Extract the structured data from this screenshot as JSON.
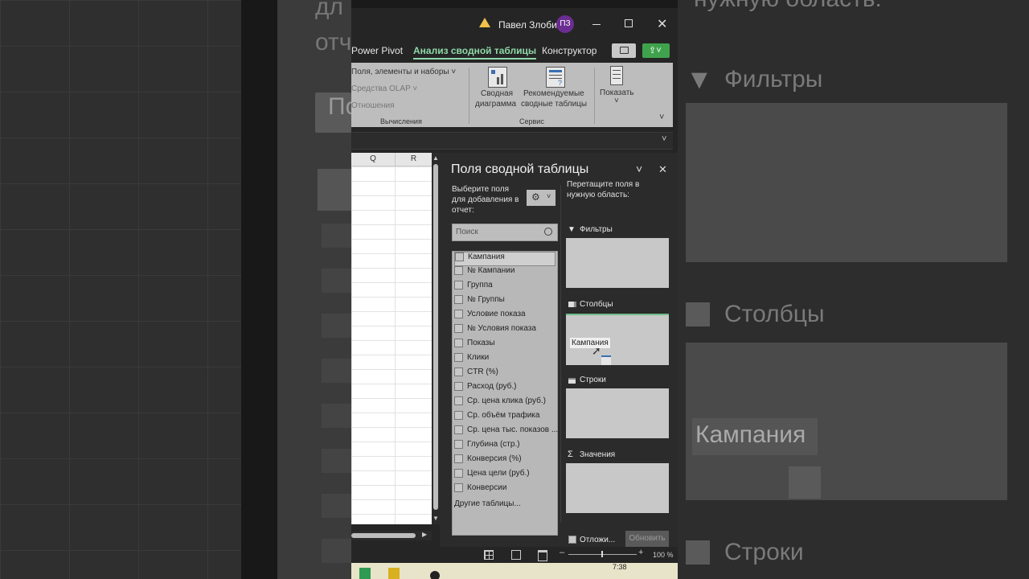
{
  "background": {
    "left_texts": [
      "дл",
      "отч",
      "Пол"
    ],
    "right_texts": {
      "filters": "Фильтры",
      "columns": "Столбцы",
      "chip": "Кампания",
      "rows": "Строки",
      "top": "нужную область:"
    }
  },
  "titlebar": {
    "user_name": "Павел Злобин",
    "avatar_initials": "ПЗ"
  },
  "ribbon_tabs": [
    "Power Pivot",
    "Анализ сводной таблицы",
    "Конструктор"
  ],
  "ribbon": {
    "calc_items": [
      "Поля, элементы и наборы ˅",
      "Средства OLAP ˅",
      "Отношения"
    ],
    "calc_group": "Вычисления",
    "pivot_chart": [
      "Сводная",
      "диаграмма"
    ],
    "recommended": [
      "Рекомендуемые",
      "сводные таблицы"
    ],
    "service_group": "Сервис",
    "show": "Показать"
  },
  "sheet": {
    "columns": [
      "Q",
      "R"
    ]
  },
  "pane": {
    "title": "Поля сводной таблицы",
    "choose_fields": [
      "Выберите поля",
      "для добавления в",
      "отчет:"
    ],
    "drag_fields": [
      "Перетащите поля в",
      "нужную область:"
    ],
    "search_placeholder": "Поиск",
    "fields": [
      "Кампания",
      "№ Кампании",
      "Группа",
      "№ Группы",
      "Условие показа",
      "№ Условия показа",
      "Показы",
      "Клики",
      "CTR (%)",
      "Расход (руб.)",
      "Ср. цена клика (руб.)",
      "Ср. объём трафика",
      "Ср. цена тыс. показов ...",
      "Глубина (стр.)",
      "Конверсия (%)",
      "Цена цели (руб.)",
      "Конверсии"
    ],
    "other_tables": "Другие таблицы...",
    "areas": {
      "filters": "Фильтры",
      "columns": "Столбцы",
      "rows": "Строки",
      "values": "Значения"
    },
    "drag_chip": "Кампания",
    "defer": "Отложи...",
    "update": "Обновить"
  },
  "status": {
    "zoom": "100 %",
    "time": "7:38"
  },
  "colors": {
    "accent": "#8fd9a8",
    "avatar": "#6b2d91",
    "share": "#3fa34d"
  }
}
